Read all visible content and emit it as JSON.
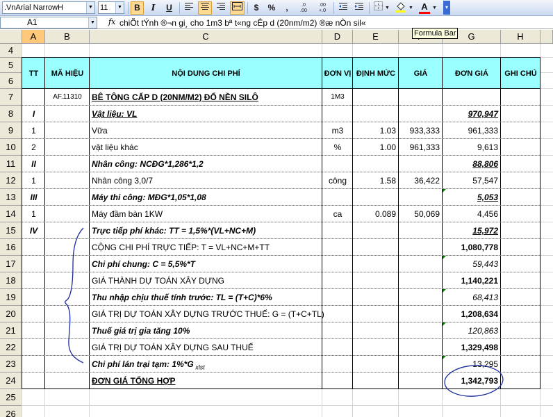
{
  "toolbar": {
    "font_name": ".VnArial NarrowH",
    "font_size": "11",
    "bold": "B",
    "italic": "I",
    "underline": "U",
    "currency": "$",
    "percent": "%",
    "comma": ",",
    "inc_decimal": ".0\n.00",
    "dec_decimal": ".00\n+.0",
    "font_color_letter": "A"
  },
  "formula_bar": {
    "name_box": "A1",
    "fx": "fx",
    "formula": "chiÕt tÝnh ®¬n gi¸ cho 1m3 bª t«ng cÊp d (20nm/m2) ®æ nÒn sil«",
    "tooltip": "Formula Bar"
  },
  "columns": [
    "A",
    "B",
    "C",
    "D",
    "E",
    "F",
    "G",
    "H"
  ],
  "rows": [
    "4",
    "5",
    "6",
    "7",
    "8",
    "9",
    "10",
    "11",
    "12",
    "13",
    "14",
    "15",
    "16",
    "17",
    "18",
    "19",
    "20",
    "21",
    "22",
    "23",
    "24",
    "25",
    "26"
  ],
  "header": {
    "tt": "TT",
    "ma_hieu": "MÃ HIỆU",
    "noi_dung": "NỘI DUNG CHI PHÍ",
    "don_vi": "ĐƠN VỊ",
    "dinh_muc": "ĐỊNH MỨC",
    "gia": "GIÁ",
    "don_gia": "ĐƠN GIÁ",
    "ghi_chu": "GHI CHÚ"
  },
  "table_rows": [
    {
      "tt": "",
      "ma": "AF.11310",
      "nd": "BÊ TÔNG CẤP D (20NM/M2) ĐỔ NỀN SILÔ",
      "dv": "1M3",
      "dm": "",
      "gia": "",
      "dg": ""
    },
    {
      "tt": "I",
      "ma": "",
      "nd": "Vật liệu: VL",
      "dv": "",
      "dm": "",
      "gia": "",
      "dg": "970,947"
    },
    {
      "tt": "1",
      "ma": "",
      "nd": "Vữa",
      "dv": "m3",
      "dm": "1.03",
      "gia": "933,333",
      "dg": "961,333"
    },
    {
      "tt": "2",
      "ma": "",
      "nd": "vật liệu khác",
      "dv": "%",
      "dm": "1.00",
      "gia": "961,333",
      "dg": "9,613"
    },
    {
      "tt": "II",
      "ma": "",
      "nd": "Nhân công: NCĐG*1,286*1,2",
      "dv": "",
      "dm": "",
      "gia": "",
      "dg": "88,806"
    },
    {
      "tt": "1",
      "ma": "",
      "nd": "Nhân công 3,0/7",
      "dv": "công",
      "dm": "1.58",
      "gia": "36,422",
      "dg": "57,547"
    },
    {
      "tt": "III",
      "ma": "",
      "nd": "Máy thi công: MĐG*1,05*1,08",
      "dv": "",
      "dm": "",
      "gia": "",
      "dg": "5,053"
    },
    {
      "tt": "1",
      "ma": "",
      "nd": "Máy đầm bàn 1KW",
      "dv": "ca",
      "dm": "0.089",
      "gia": "50,069",
      "dg": "4,456"
    },
    {
      "tt": "IV",
      "ma": "",
      "nd": "Trực tiếp phí khác: TT = 1,5%*(VL+NC+M)",
      "dv": "",
      "dm": "",
      "gia": "",
      "dg": "15,972"
    },
    {
      "tt": "",
      "ma": "",
      "nd": "CỘNG CHI PHÍ TRỰC TIẾP: T = VL+NC+M+TT",
      "dv": "",
      "dm": "",
      "gia": "",
      "dg": "1,080,778"
    },
    {
      "tt": "",
      "ma": "",
      "nd": "Chi phí chung: C = 5,5%*T",
      "dv": "",
      "dm": "",
      "gia": "",
      "dg": "59,443"
    },
    {
      "tt": "",
      "ma": "",
      "nd": "GIÁ THÀNH DỰ TOÁN XÂY DỰNG",
      "dv": "",
      "dm": "",
      "gia": "",
      "dg": "1,140,221"
    },
    {
      "tt": "",
      "ma": "",
      "nd": "Thu nhập chịu thuế tính trước: TL = (T+C)*6%",
      "dv": "",
      "dm": "",
      "gia": "",
      "dg": "68,413"
    },
    {
      "tt": "",
      "ma": "",
      "nd": "GIÁ TRỊ DỰ TOÁN XÂY DỰNG TRƯỚC THUẾ: G = (T+C+TL)",
      "dv": "",
      "dm": "",
      "gia": "",
      "dg": "1,208,634"
    },
    {
      "tt": "",
      "ma": "",
      "nd": "Thuế giá trị gia tăng 10%",
      "dv": "",
      "dm": "",
      "gia": "",
      "dg": "120,863"
    },
    {
      "tt": "",
      "ma": "",
      "nd": "GIÁ TRỊ DỰ TOÁN XÂY DỰNG SAU THUẾ",
      "dv": "",
      "dm": "",
      "gia": "",
      "dg": "1,329,498"
    },
    {
      "tt": "",
      "ma": "",
      "nd": "Chi phí lán trại tạm: 1%*G",
      "nd_sub": "xlst",
      "dv": "",
      "dm": "",
      "gia": "",
      "dg": "13,295"
    },
    {
      "tt": "",
      "ma": "",
      "nd": "ĐƠN GIÁ TỔNG HỢP",
      "dv": "",
      "dm": "",
      "gia": "",
      "dg": "1,342,793"
    }
  ]
}
